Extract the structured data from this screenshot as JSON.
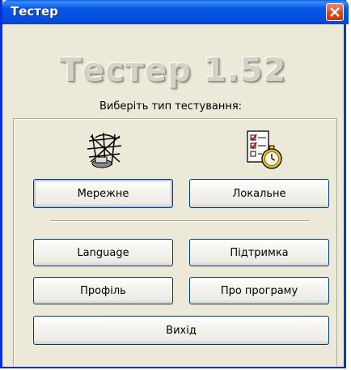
{
  "window": {
    "title": "Тестер",
    "banner": "Тестер 1.52",
    "prompt": "Виберіть тип тестування:"
  },
  "test_types": {
    "network_icon": "network-globe-icon",
    "local_icon": "checklist-stopwatch-icon",
    "network_label": "Мережне",
    "local_label": "Локальне"
  },
  "buttons": {
    "language": "Language",
    "support": "Підтримка",
    "profile": "Профіль",
    "about": "Про програму",
    "exit": "Вихід"
  },
  "colors": {
    "title_bar": "#0754e3",
    "close_button": "#d2461a",
    "dialog_bg": "#ece9d8"
  }
}
